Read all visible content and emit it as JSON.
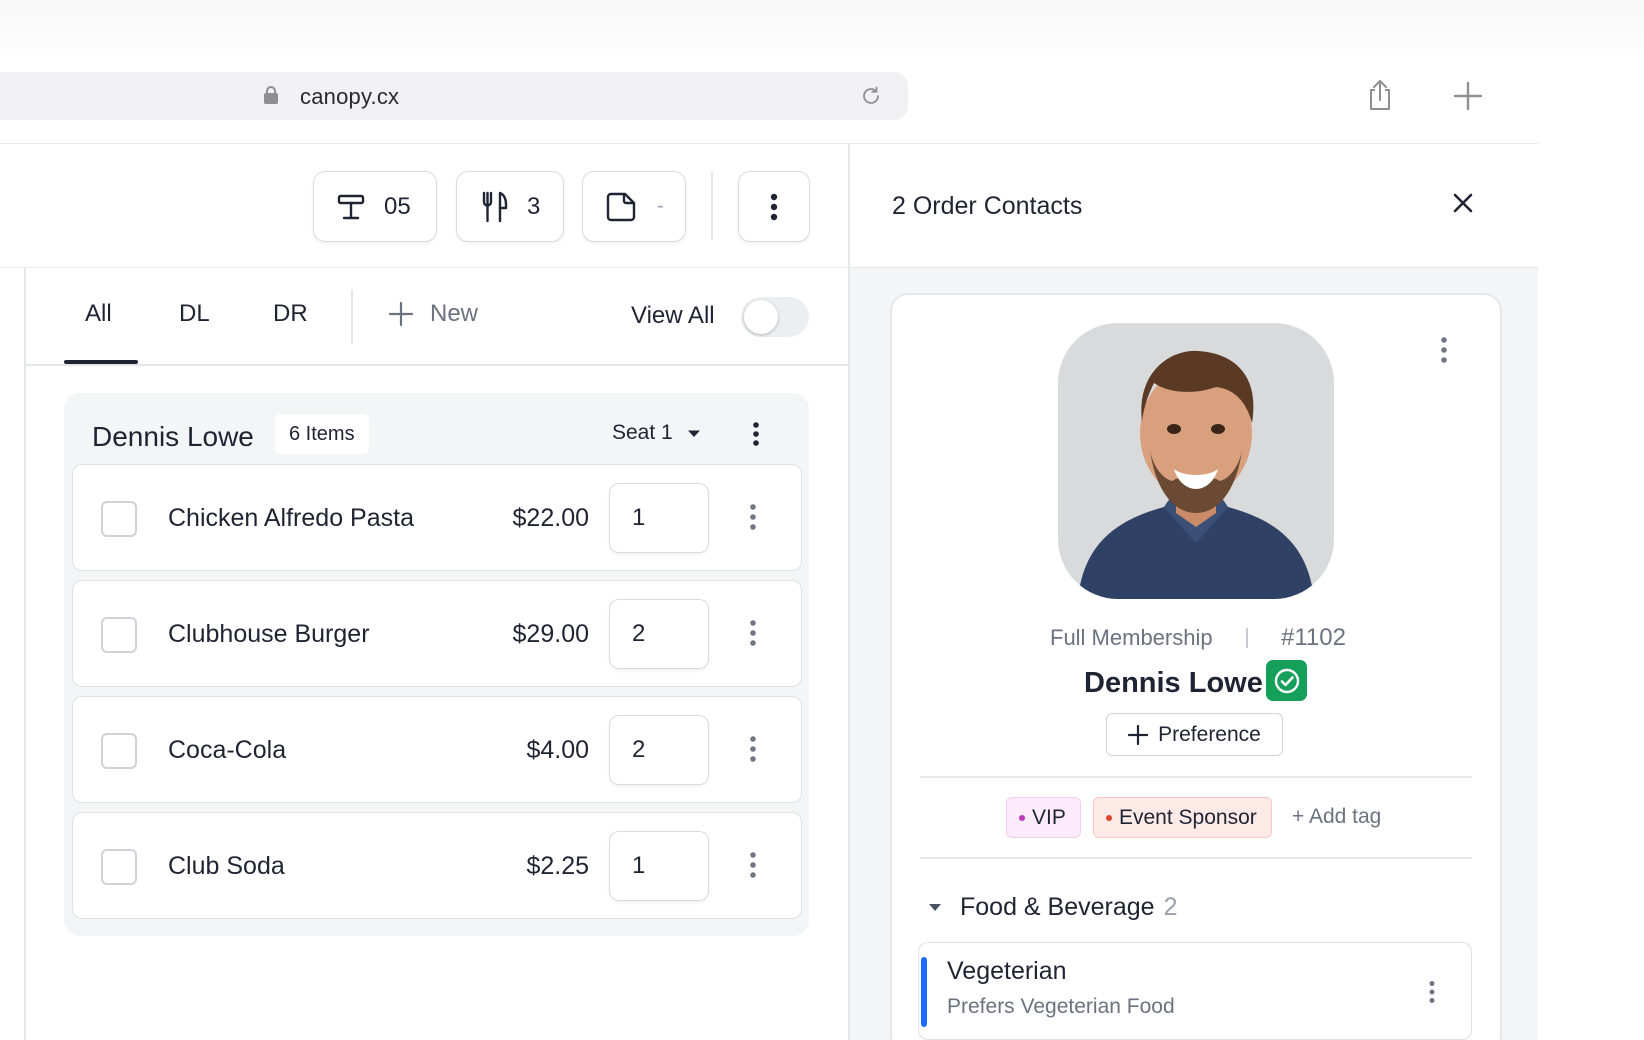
{
  "browser": {
    "url": "canopy.cx"
  },
  "toolbar": {
    "table_number": "05",
    "guest_count": "3",
    "note_value": "-"
  },
  "tabs": {
    "all": "All",
    "dl": "DL",
    "dr": "DR",
    "new_label": "New",
    "view_all_label": "View All",
    "view_all_enabled": false
  },
  "order_group": {
    "guest_name": "Dennis Lowe",
    "items_count": "6 Items",
    "seat": "Seat 1",
    "items": [
      {
        "name": "Chicken Alfredo Pasta",
        "price": "$22.00",
        "qty": "1",
        "checked": false
      },
      {
        "name": "Clubhouse Burger",
        "price": "$29.00",
        "qty": "2",
        "checked": false
      },
      {
        "name": "Coca-Cola",
        "price": "$4.00",
        "qty": "2",
        "checked": false
      },
      {
        "name": "Club Soda",
        "price": "$2.25",
        "qty": "1",
        "checked": false
      }
    ]
  },
  "panel": {
    "title": "2 Order Contacts",
    "contact": {
      "membership": "Full Membership",
      "member_id": "#1102",
      "name": "Dennis Lowe",
      "verified": true,
      "preference_button": "Preference",
      "tags": [
        {
          "label": "VIP",
          "color": "#c03ac0"
        },
        {
          "label": "Event Sponsor",
          "color": "#e0452f"
        }
      ],
      "add_tag": "+ Add tag",
      "section": {
        "title": "Food & Beverage",
        "count": "2",
        "items": [
          {
            "title": "Vegeterian",
            "description": "Prefers Vegeterian Food",
            "accent": "#1a6dff"
          }
        ]
      }
    }
  },
  "colors": {
    "text_primary": "#1f2433",
    "text_muted": "#6b7280",
    "verified_green": "#14a05a",
    "accent_blue": "#1a6dff"
  }
}
